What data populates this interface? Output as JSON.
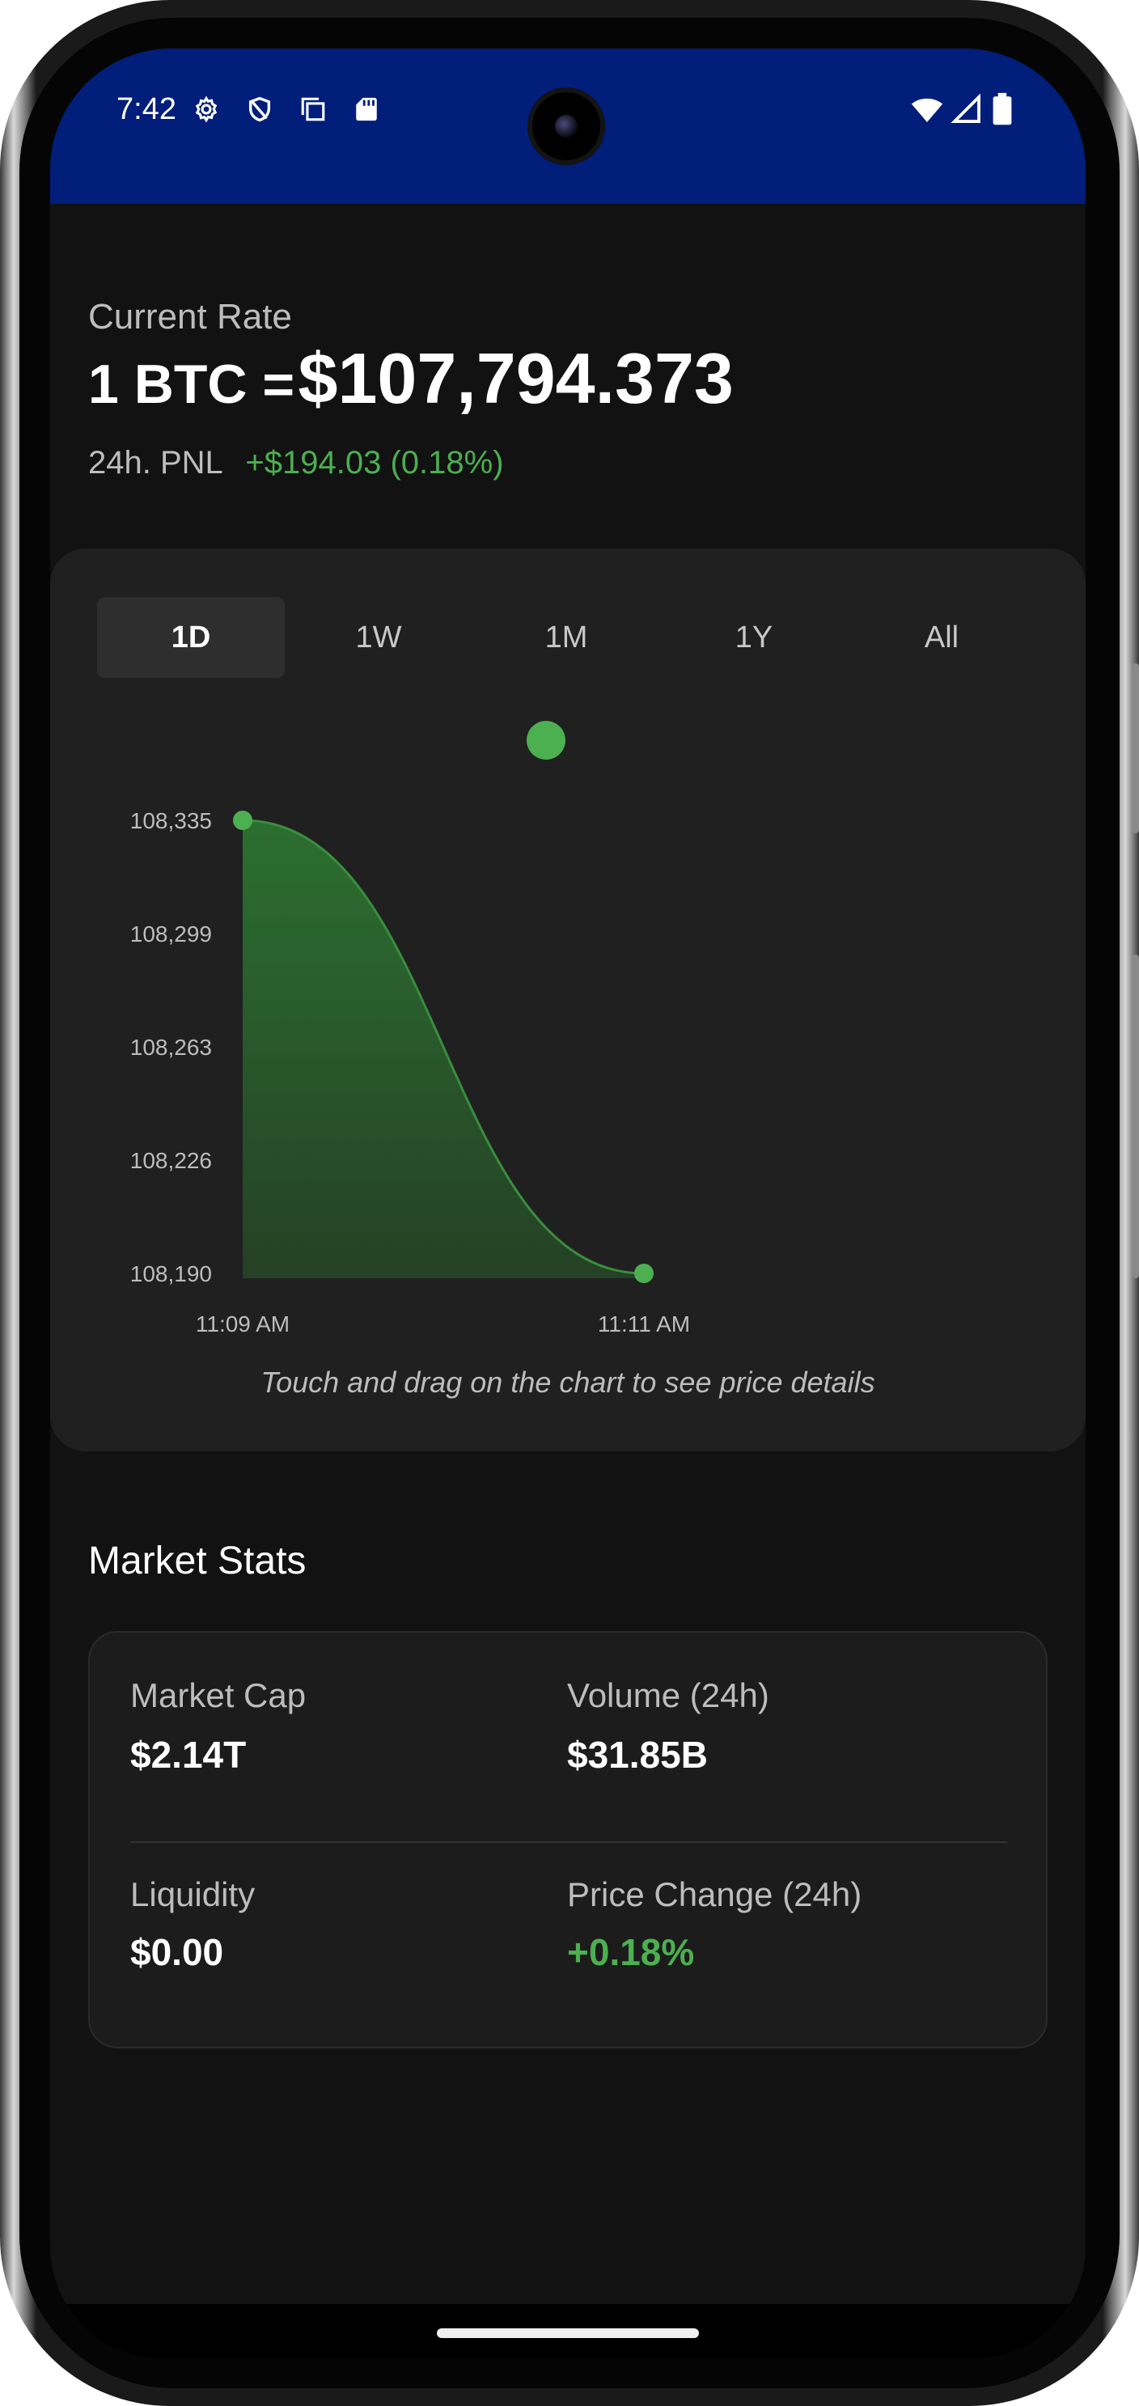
{
  "status_bar": {
    "time": "7:42",
    "left_icons": [
      "gear-icon",
      "shield-icon",
      "copy-icon",
      "sd-card-icon"
    ],
    "right_icons": [
      "wifi-icon",
      "signal-icon",
      "battery-icon"
    ]
  },
  "rate": {
    "label": "Current Rate",
    "prefix": "1 BTC =",
    "value": "$107,794.373",
    "pnl_label": "24h. PNL",
    "pnl_value": "+$194.03 (0.18%)"
  },
  "chart": {
    "tabs": [
      {
        "label": "1D",
        "active": true
      },
      {
        "label": "1W",
        "active": false
      },
      {
        "label": "1M",
        "active": false
      },
      {
        "label": "1Y",
        "active": false
      },
      {
        "label": "All",
        "active": false
      }
    ],
    "hint": "Touch and drag on the chart to see price details"
  },
  "chart_data": {
    "type": "area",
    "x": [
      "11:09 AM",
      "11:11 AM"
    ],
    "series": [
      {
        "values": [
          108335,
          108190
        ]
      }
    ],
    "y_ticks": [
      "108,335",
      "108,299",
      "108,263",
      "108,226",
      "108,190"
    ],
    "x_ticks": [
      "11:09 AM",
      "11:11 AM"
    ],
    "ylim": [
      108190,
      108335
    ],
    "grid": false,
    "color": "#4caf50"
  },
  "stats": {
    "title": "Market Stats",
    "market_cap_label": "Market Cap",
    "market_cap_value": "$2.14T",
    "volume_label": "Volume (24h)",
    "volume_value": "$31.85B",
    "liquidity_label": "Liquidity",
    "liquidity_value": "$0.00",
    "price_change_label": "Price Change (24h)",
    "price_change_value": "+0.18%"
  },
  "colors": {
    "accent_green": "#4caf50",
    "status_bar": "#001e7a",
    "background": "#121212"
  }
}
